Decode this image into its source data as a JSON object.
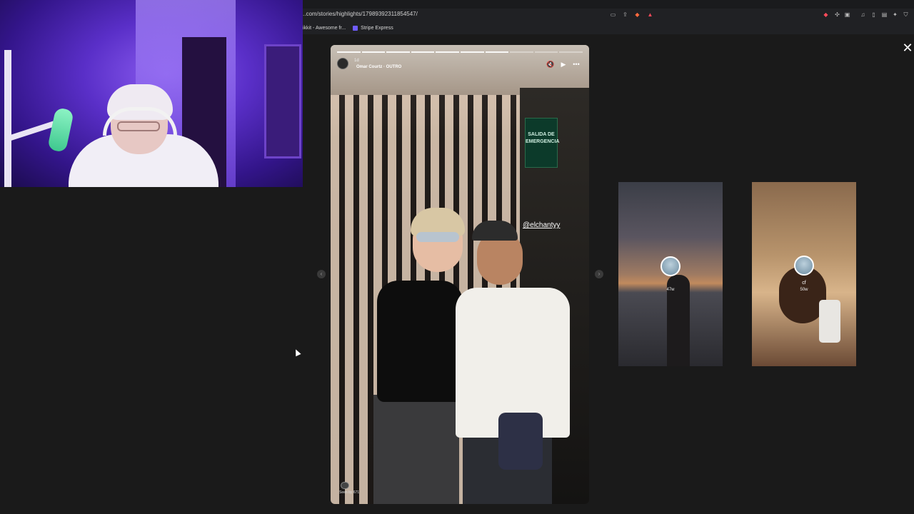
{
  "browser": {
    "url": "..com/stories/highlights/17989392311854547/",
    "bookmarks": [
      {
        "label": "ikkit - Awesome fr..."
      },
      {
        "label": "Stripe Express"
      }
    ]
  },
  "viewer": {
    "close_icon": "close-icon",
    "progress": {
      "segments_total": 10,
      "segments_done": 7
    },
    "story": {
      "time": "1d",
      "audio": "Omar Courtz · OUTRO",
      "mention": "@elchantyy",
      "seen_by": "Seen by 671",
      "exit_sign": "SALIDA DE EMERGENCIA"
    },
    "thumbnails": [
      {
        "name": "",
        "time": "47w"
      },
      {
        "name": "cf",
        "time": "50w"
      }
    ]
  },
  "colors": {
    "background": "#1a1a1a",
    "chrome": "#202124",
    "accent": "#6f5cff"
  }
}
